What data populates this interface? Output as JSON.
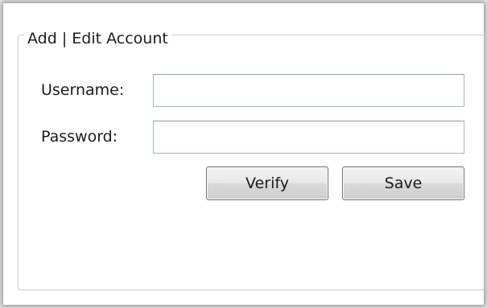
{
  "group": {
    "title": "Add | Edit Account"
  },
  "form": {
    "username_label": "Username:",
    "username_value": "",
    "password_label": "Password:",
    "password_value": ""
  },
  "buttons": {
    "verify_label": "Verify",
    "save_label": "Save"
  }
}
